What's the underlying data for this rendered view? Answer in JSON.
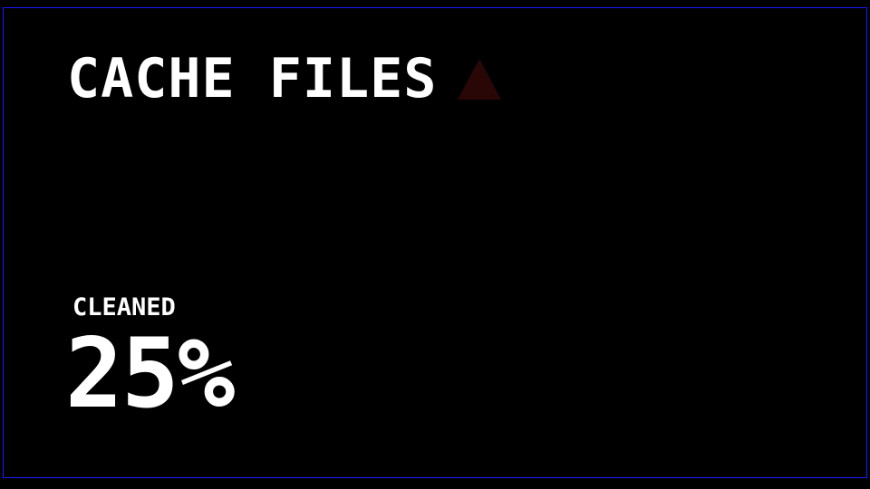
{
  "header": {
    "title": "CACHE FILES",
    "status_icon": "warning-triangle-icon",
    "status_icon_color": "#2a0707"
  },
  "progress": {
    "label": "CLEANED",
    "value_text": "25%",
    "value_percent": 25
  },
  "colors": {
    "background": "#000000",
    "frame_border": "#1a1aff",
    "text": "#ffffff"
  }
}
